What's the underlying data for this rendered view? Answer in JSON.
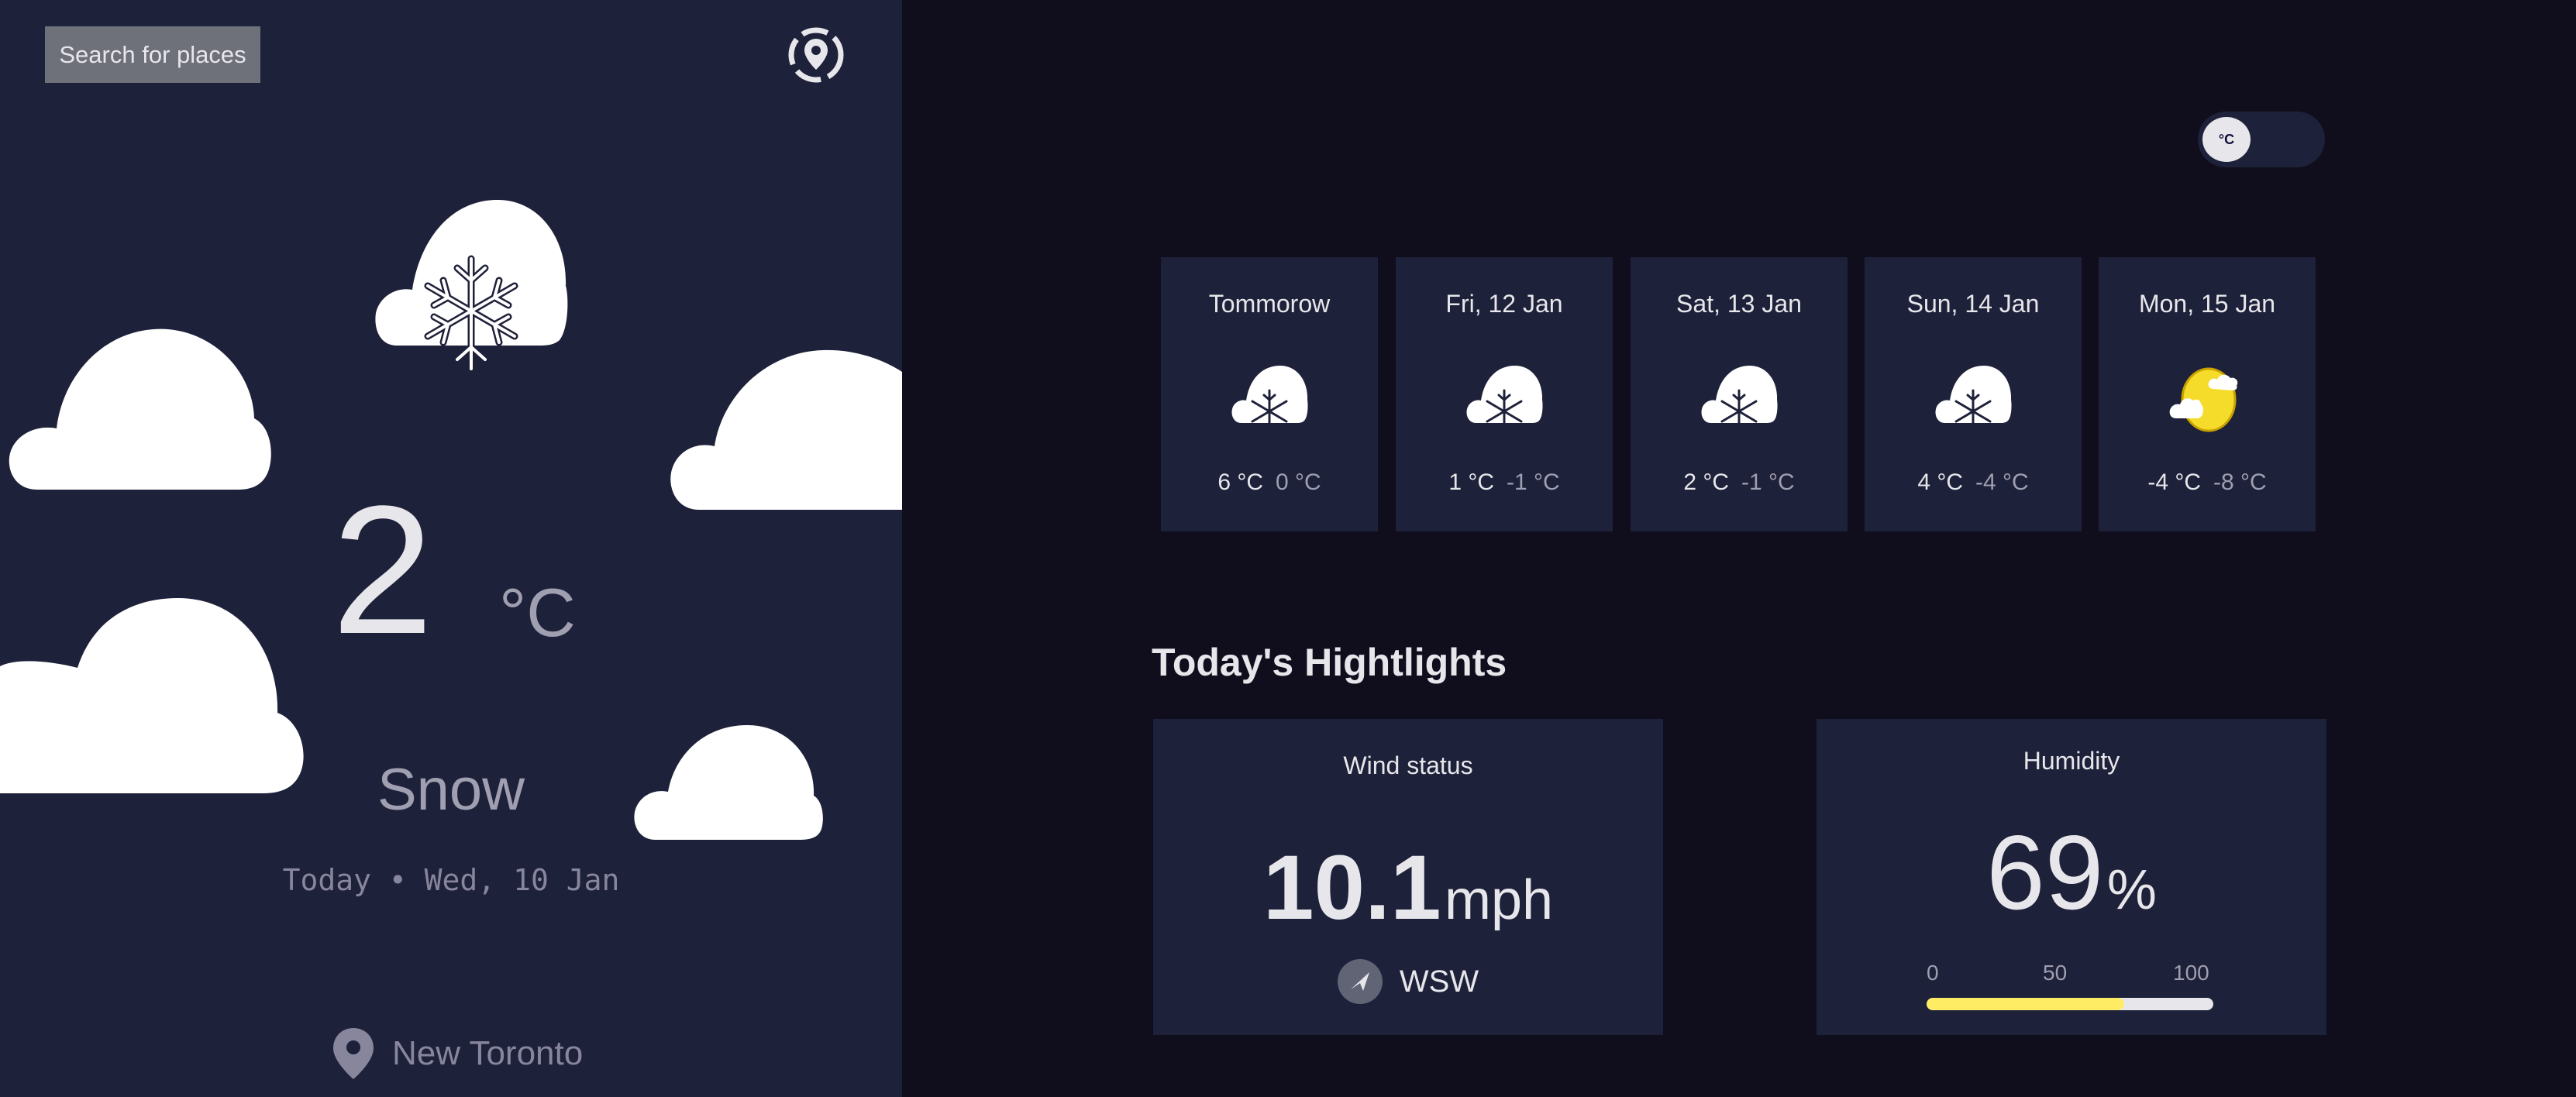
{
  "sidebar": {
    "search_label": "Search for places",
    "current": {
      "icon": "snow-icon",
      "temperature": "2",
      "unit": "°C",
      "condition": "Snow",
      "date": "Today • Wed, 10 Jan",
      "location": "New Toronto"
    }
  },
  "toggle": {
    "unit_label": "°C"
  },
  "forecast": [
    {
      "date": "Tommorow",
      "icon": "snow-icon",
      "max": "6 °C",
      "min": "0 °C"
    },
    {
      "date": "Fri, 12 Jan",
      "icon": "snow-icon",
      "max": "1 °C",
      "min": "-1 °C"
    },
    {
      "date": "Sat, 13 Jan",
      "icon": "snow-icon",
      "max": "2 °C",
      "min": "-1 °C"
    },
    {
      "date": "Sun, 14 Jan",
      "icon": "snow-icon",
      "max": "4 °C",
      "min": "-4 °C"
    },
    {
      "date": "Mon, 15 Jan",
      "icon": "partly-sunny-icon",
      "max": "-4 °C",
      "min": "-8 °C"
    }
  ],
  "highlights": {
    "title": "Today's Hightlights",
    "wind": {
      "label": "Wind status",
      "value": "10.1",
      "unit": "mph",
      "direction": "WSW"
    },
    "humidity": {
      "label": "Humidity",
      "value": "69",
      "unit": "%",
      "percent": 69,
      "scale": [
        "0",
        "50",
        "100"
      ]
    }
  },
  "colors": {
    "sidebar_bg": "#1e213a",
    "page_bg": "#100e1d",
    "accent_yellow": "#ffec65",
    "search_button": "#6e707a"
  }
}
